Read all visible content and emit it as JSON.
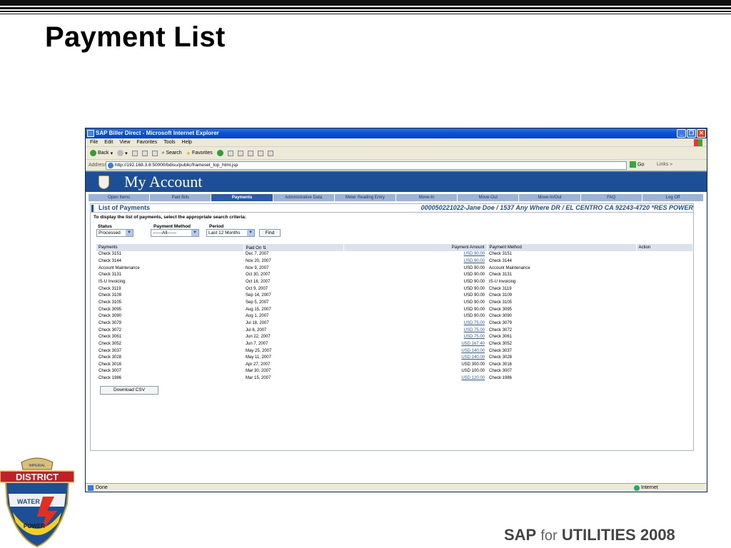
{
  "slide": {
    "title": "Payment List",
    "footer": {
      "sap": "SAP",
      "for": "for",
      "utilities": "UTILITIES 2008"
    },
    "logo_text": {
      "top": "IMPERIAL",
      "district": "DISTRICT",
      "water": "WATER",
      "power": "POWER"
    }
  },
  "window": {
    "title": "SAP Biller Direct - Microsoft Internet Explorer",
    "menu": [
      "File",
      "Edit",
      "View",
      "Favorites",
      "Tools",
      "Help"
    ],
    "toolbar": {
      "back": "Back",
      "search": "Search",
      "favorites": "Favorites"
    },
    "address": {
      "label": "Address",
      "url": "http://192.168.3.8:50000/bdisu/public/frameset_top_html.jsp",
      "go": "Go",
      "links": "Links"
    },
    "status": {
      "left": "Done",
      "zone": "Internet"
    }
  },
  "page": {
    "brand": "My Account",
    "tabs": [
      "Open Items",
      "Paid Bills",
      "Payments",
      "Administrative Data",
      "Meter Reading Entry",
      "Move-In",
      "Move-Out",
      "Move-In/Out",
      "FAQ",
      "Log Off"
    ],
    "active_tab": "Payments",
    "panel_title": "List of Payments",
    "account_info": "000050221022-Jane Doe / 1537 Any Where DR / EL CENTRO CA 92243-4720 *RES POWER",
    "instruction": "To display the list of payments, select the appropriate search criteria:",
    "criteria": {
      "status_label": "Status",
      "status_value": "Processed",
      "method_label": "Payment Method",
      "method_value": "------All------",
      "period_label": "Period",
      "period_value": "Last 12 Months",
      "find_label": "Find"
    },
    "table": {
      "headers": [
        "Payments",
        "Paid On",
        "Payment Amount",
        "Payment Method",
        "Action"
      ],
      "rows": [
        {
          "payment": "Check 3151",
          "paid_on": "Dec 7, 2007",
          "amount": "USD 90.00",
          "link": true,
          "method": "Check 3151"
        },
        {
          "payment": "Check 3144",
          "paid_on": "Nov 20, 2007",
          "amount": "USD 90.00",
          "link": true,
          "method": "Check 3144"
        },
        {
          "payment": "Account Maintenance",
          "paid_on": "Nov 9, 2007",
          "amount": "USD 90.00",
          "link": false,
          "method": "Account Maintenance"
        },
        {
          "payment": "Check 3131",
          "paid_on": "Oct 30, 2007",
          "amount": "USD 90.00",
          "link": false,
          "method": "Check 3131"
        },
        {
          "payment": "IS-U Invoicing",
          "paid_on": "Oct 16, 2007",
          "amount": "USD 90.00",
          "link": false,
          "method": "IS-U Invoicing"
        },
        {
          "payment": "Check 3119",
          "paid_on": "Oct 9, 2007",
          "amount": "USD 90.00",
          "link": false,
          "method": "Check 3119"
        },
        {
          "payment": "Check 3109",
          "paid_on": "Sep 14, 2007",
          "amount": "USD 90.00",
          "link": false,
          "method": "Check 3109"
        },
        {
          "payment": "Check 3105",
          "paid_on": "Sep 5, 2007",
          "amount": "USD 90.00",
          "link": false,
          "method": "Check 3105"
        },
        {
          "payment": "Check 3095",
          "paid_on": "Aug 15, 2007",
          "amount": "USD 90.00",
          "link": false,
          "method": "Check 3095"
        },
        {
          "payment": "Check 3090",
          "paid_on": "Aug 1, 2007",
          "amount": "USD 90.00",
          "link": false,
          "method": "Check 3090"
        },
        {
          "payment": "Check 3079",
          "paid_on": "Jul 18, 2007",
          "amount": "USD 75.00",
          "link": true,
          "method": "Check 3079"
        },
        {
          "payment": "Check 3072",
          "paid_on": "Jul 6, 2007",
          "amount": "USD 75.00",
          "link": true,
          "method": "Check 3072"
        },
        {
          "payment": "Check 3061",
          "paid_on": "Jun 22, 2007",
          "amount": "USD 75.00",
          "link": true,
          "method": "Check 3061"
        },
        {
          "payment": "Check 3052",
          "paid_on": "Jun 7, 2007",
          "amount": "USD 167.40",
          "link": true,
          "method": "Check 3052"
        },
        {
          "payment": "Check 3037",
          "paid_on": "May 25, 2007",
          "amount": "USD 140.00",
          "link": true,
          "method": "Check 3037"
        },
        {
          "payment": "Check 3028",
          "paid_on": "May 11, 2007",
          "amount": "USD 140.00",
          "link": true,
          "method": "Check 3028"
        },
        {
          "payment": "Check 3016",
          "paid_on": "Apr 27, 2007",
          "amount": "USD 300.00",
          "link": false,
          "method": "Check 3016"
        },
        {
          "payment": "Check 3007",
          "paid_on": "Mar 30, 2007",
          "amount": "USD 100.00",
          "link": false,
          "method": "Check 3007"
        },
        {
          "payment": "Check 1986",
          "paid_on": "Mar 15, 2007",
          "amount": "USD 120.00",
          "link": true,
          "method": "Check 1986"
        }
      ]
    },
    "download_label": "Download CSV"
  },
  "colors": {
    "accent": "#1d4f96",
    "link": "#2a5aa8",
    "tab_bar": "#9db3d6",
    "header_row": "#dbe2ee"
  }
}
